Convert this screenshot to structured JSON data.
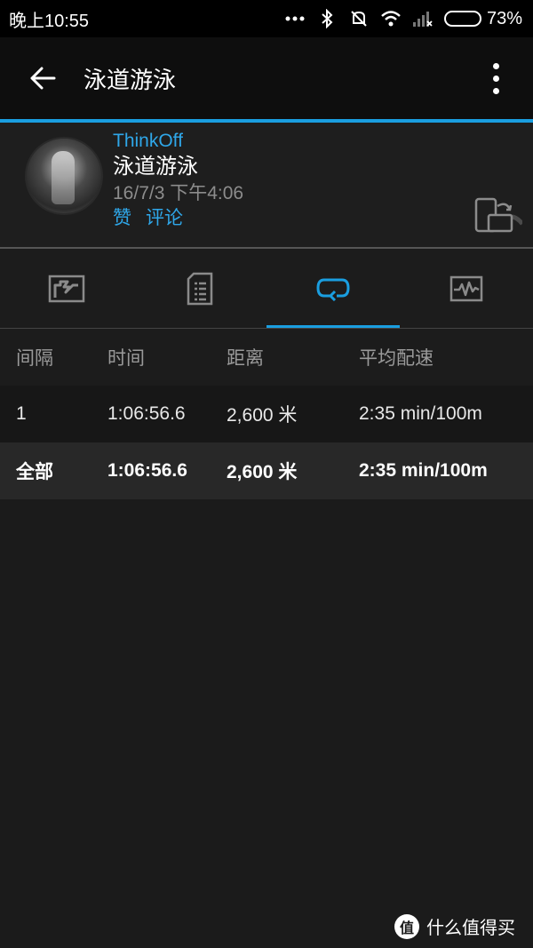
{
  "statusbar": {
    "time": "晚上10:55",
    "battery_percent": "73%",
    "battery_level": 0.73,
    "icons": [
      "more-dots-icon",
      "bluetooth-icon",
      "mute-icon",
      "wifi-icon",
      "signal-icon",
      "battery-icon"
    ]
  },
  "appbar": {
    "title": "泳道游泳"
  },
  "activity": {
    "username": "ThinkOff",
    "type": "泳道游泳",
    "date": "16/7/3",
    "time": "下午4:06",
    "like_label": "赞",
    "comment_label": "评论"
  },
  "tabs": [
    {
      "icon": "summary-map-icon",
      "active": false
    },
    {
      "icon": "details-list-icon",
      "active": false
    },
    {
      "icon": "laps-loop-icon",
      "active": true
    },
    {
      "icon": "chart-icon",
      "active": false
    }
  ],
  "table": {
    "headers": [
      "间隔",
      "时间",
      "距离",
      "平均配速"
    ],
    "rows": [
      [
        "1",
        "1:06:56.6",
        "2,600 米",
        "2:35 min/100m"
      ]
    ],
    "total": [
      "全部",
      "1:06:56.6",
      "2,600 米",
      "2:35 min/100m"
    ]
  },
  "watermark": {
    "badge": "值",
    "text": "什么值得买"
  },
  "colors": {
    "accent": "#1a9ee0",
    "link": "#2fa7e9",
    "background": "#1b1b1b"
  }
}
